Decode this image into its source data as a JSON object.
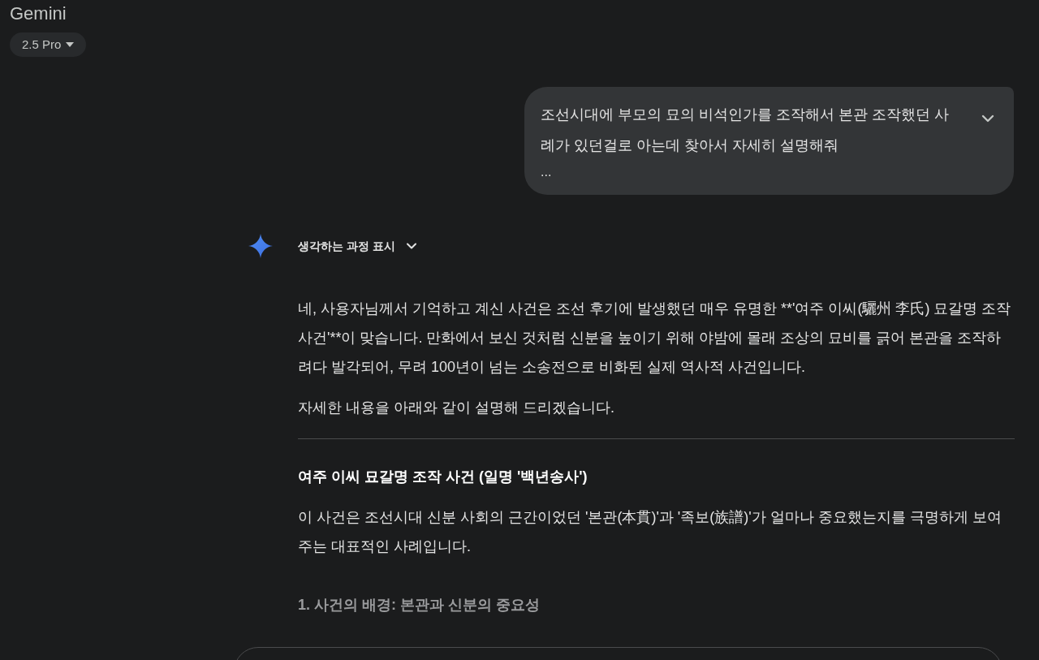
{
  "app_title": "Gemini",
  "model_picker": {
    "label": "2.5 Pro"
  },
  "user_message": {
    "text": "조선시대에 부모의 묘의 비석인가를 조작해서 본관 조작했던 사례가 있던걸로 아는데 찾아서 자세히 설명해줘",
    "more": "...",
    "expanded": false
  },
  "response": {
    "thinking_toggle": {
      "label": "생각하는 과정 표시",
      "expanded": false
    },
    "blocks": [
      {
        "kind": "paragraph",
        "text": "네, 사용자님께서 기억하고 계신 사건은 조선 후기에 발생했던 매우 유명한 **'여주 이씨(驪州 李氏) 묘갈명 조작 사건'**이 맞습니다. 만화에서 보신 것처럼 신분을 높이기 위해 야밤에 몰래 조상의 묘비를 긁어 본관을 조작하려다 발각되어, 무려 100년이 넘는 소송전으로 비화된 실제 역사적 사건입니다."
      },
      {
        "kind": "paragraph",
        "text": "자세한 내용을 아래와 같이 설명해 드리겠습니다."
      },
      {
        "kind": "divider"
      },
      {
        "kind": "heading",
        "text": "여주 이씨 묘갈명 조작 사건 (일명 '백년송사')"
      },
      {
        "kind": "paragraph",
        "text": "이 사건은 조선시대 신분 사회의 근간이었던 '본관(本貫)'과 '족보(族譜)'가 얼마나 중요했는지를 극명하게 보여주는 대표적인 사례입니다."
      },
      {
        "kind": "subheading",
        "text": "1. 사건의 배경: 본관과 신분의 중요성"
      }
    ]
  }
}
